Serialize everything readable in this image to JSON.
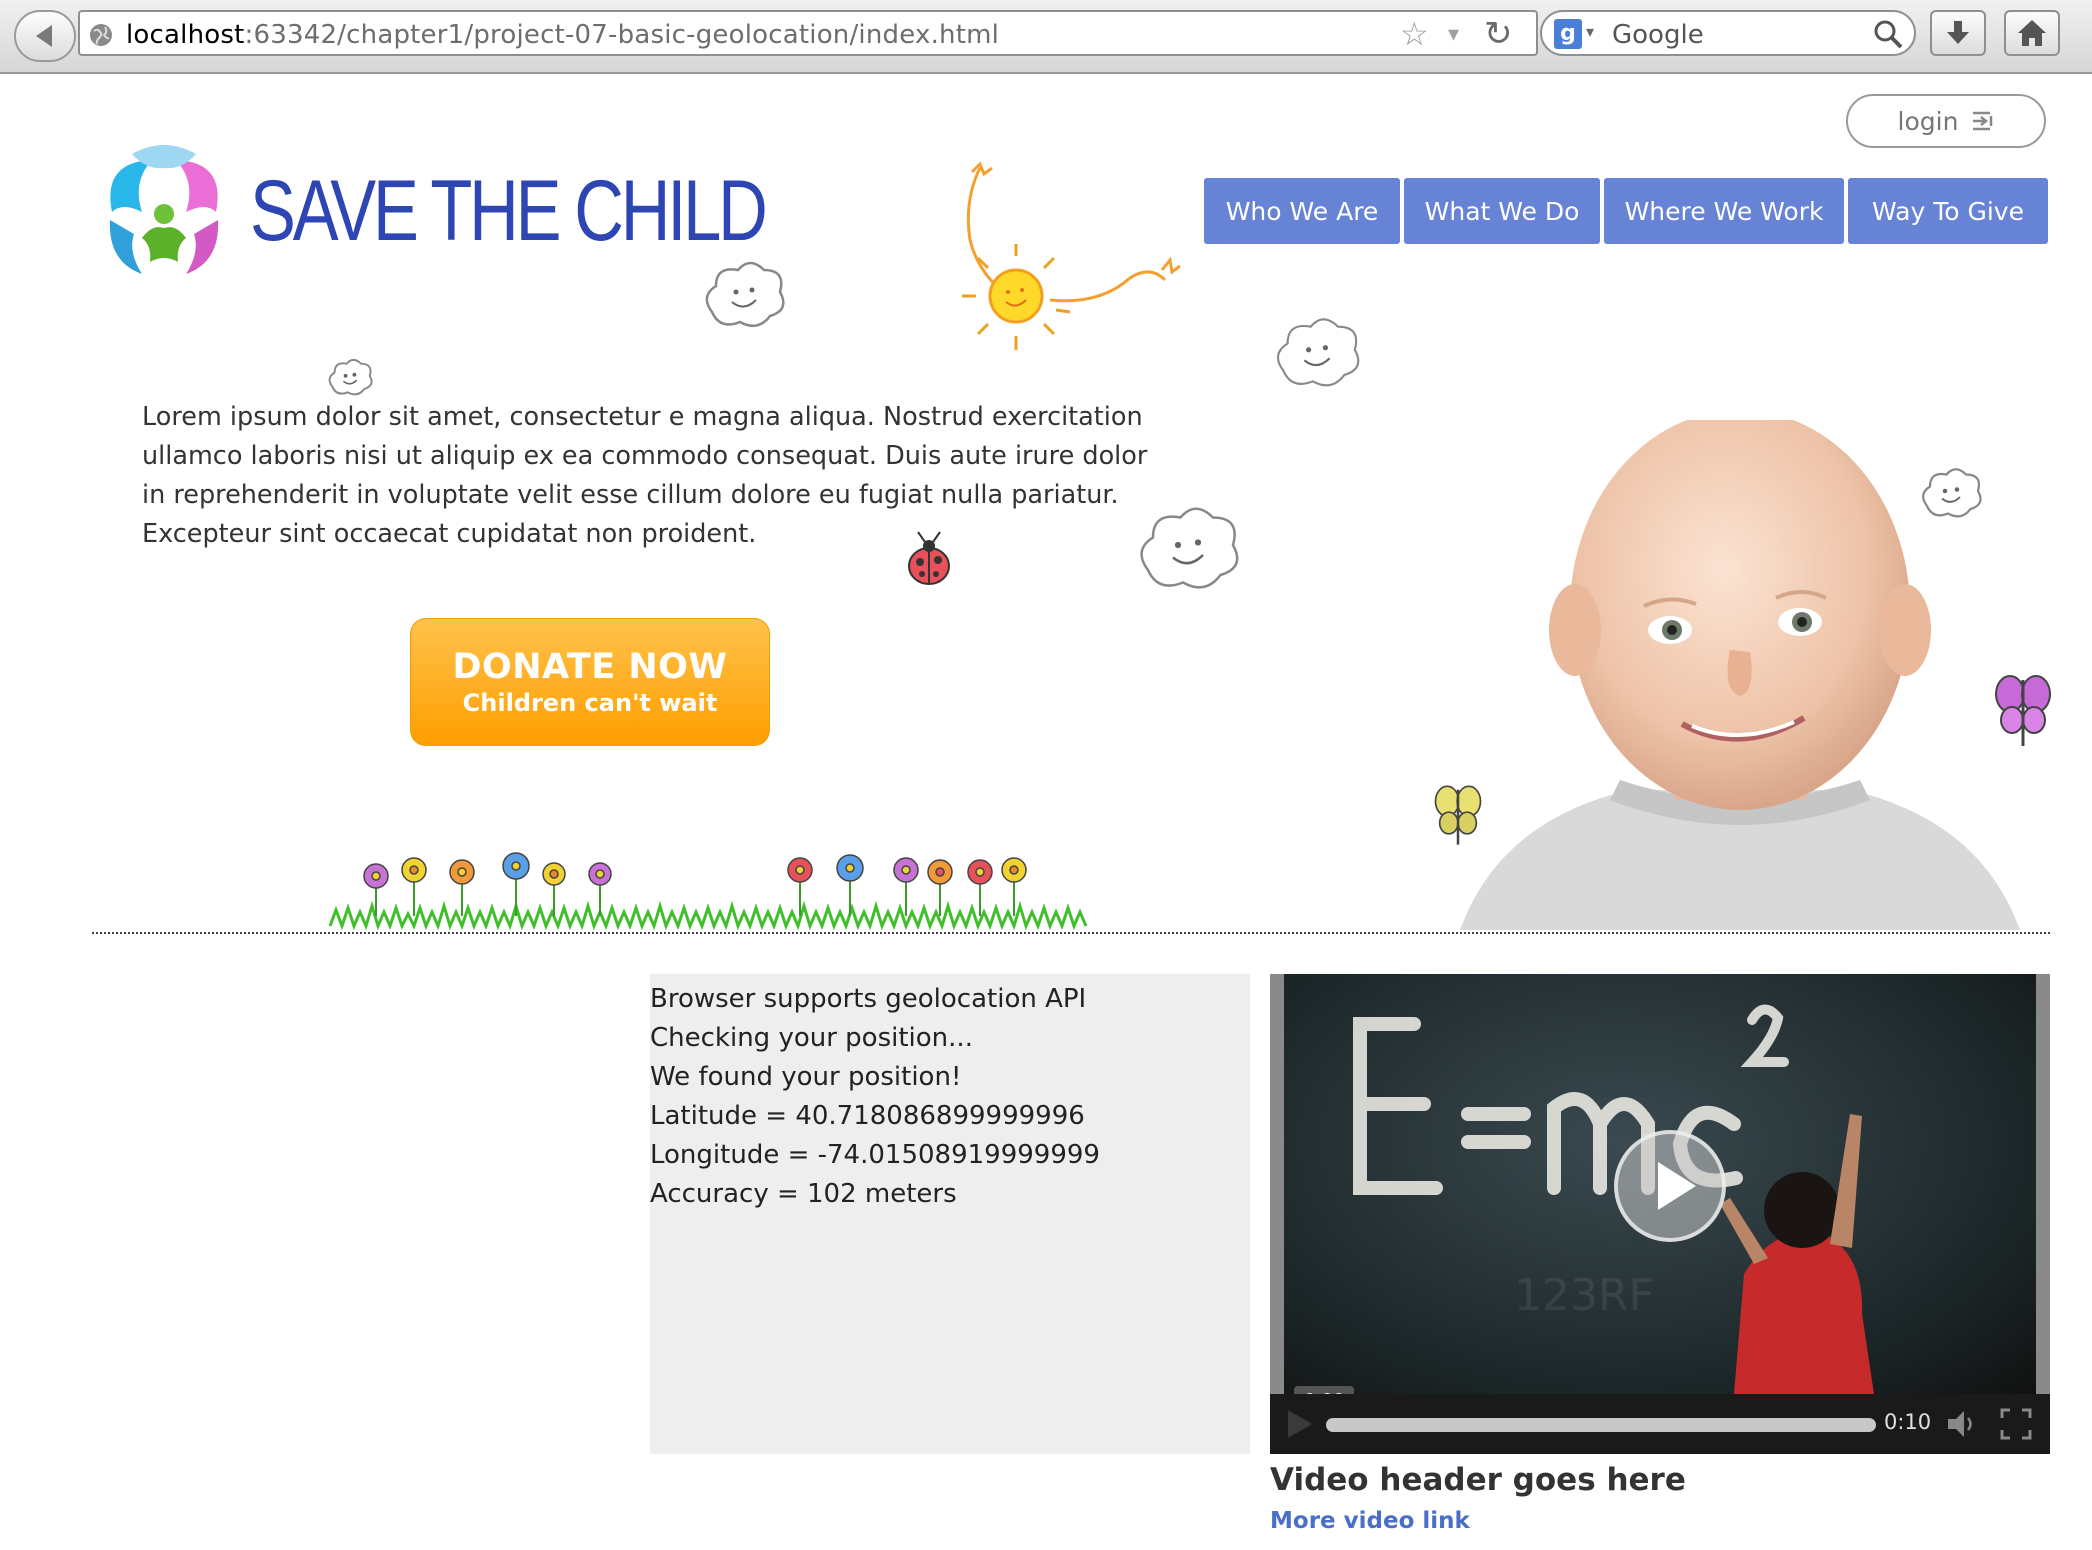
{
  "browser": {
    "url_host": "localhost",
    "url_path": ":63342/chapter1/project-07-basic-geolocation/index.html",
    "search_engine": "Google"
  },
  "header": {
    "login_label": "login",
    "logo_text": "SAVE THE CHILD",
    "nav": [
      "Who We Are",
      "What We Do",
      "Where We Work",
      "Way To Give"
    ]
  },
  "intro": {
    "text": "Lorem ipsum dolor sit amet, consectetur e magna aliqua. Nostrud exercitation ullamco laboris nisi ut aliquip ex ea commodo consequat. Duis aute irure dolor in reprehenderit in voluptate velit esse cillum dolore eu fugiat nulla pariatur. Excepteur sint occaecat cupidatat non proident."
  },
  "donate": {
    "title": "DONATE NOW",
    "subtitle": "Children can't wait"
  },
  "geolocation": {
    "lines": [
      "Browser supports geolocation API",
      "Checking your position...",
      "We found your position!",
      "Latitude = 40.718086899999996",
      "Longitude = -74.01508919999999",
      "Accuracy = 102 meters"
    ]
  },
  "video": {
    "current_time": "0:00",
    "duration": "0:10",
    "progress": 0,
    "header": "Video header goes here",
    "link": "More video link"
  },
  "colors": {
    "nav_bg": "#6783d6",
    "logo_blue": "#2e46b3",
    "donate_orange": "#ff9e00",
    "link_blue": "#4a6fc7",
    "geo_panel_bg": "#eeeeee"
  },
  "icons": [
    "back-arrow-icon",
    "globe-icon",
    "star-icon",
    "reload-icon",
    "google-icon",
    "magnifier-icon",
    "download-icon",
    "home-icon",
    "login-icon",
    "play-icon",
    "volume-icon",
    "fullscreen-icon"
  ]
}
